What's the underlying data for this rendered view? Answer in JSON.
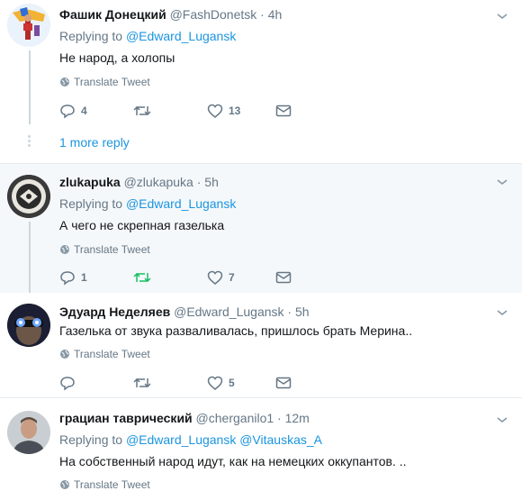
{
  "tweets": [
    {
      "name": "Фашик Донецкий",
      "handle": "@FashDonetsk",
      "time": "· 4h",
      "reply_prefix": "Replying to",
      "reply_to": "@Edward_Lugansk",
      "text": "Не народ, а холопы",
      "translate": "Translate Tweet",
      "replies": "4",
      "retweets": "",
      "likes": "13"
    },
    {
      "name": "zlukapuka",
      "handle": "@zlukapuka",
      "time": "· 5h",
      "reply_prefix": "Replying to",
      "reply_to": "@Edward_Lugansk",
      "text": "А чего не скрепная газелька",
      "translate": "Translate Tweet",
      "replies": "1",
      "retweets": "",
      "likes": "7"
    },
    {
      "name": "Эдуард Неделяев",
      "handle": "@Edward_Lugansk",
      "time": "· 5h",
      "text": "Газелька от звука разваливалась, пришлось брать Мерина..",
      "translate": "Translate Tweet",
      "replies": "",
      "retweets": "",
      "likes": "5"
    },
    {
      "name": "грациан таврический",
      "handle": "@cherganilo1",
      "time": "· 12m",
      "reply_prefix": "Replying to",
      "reply_to": "@Edward_Lugansk @Vitauskas_A",
      "text": "На собственный народ идут, как на немецких оккупантов. ..",
      "translate": "Translate Tweet"
    }
  ],
  "more_reply": "1 more reply",
  "colors": {
    "accent": "#1b95e0",
    "retweet_active": "#17bf63",
    "muted": "#657786"
  }
}
